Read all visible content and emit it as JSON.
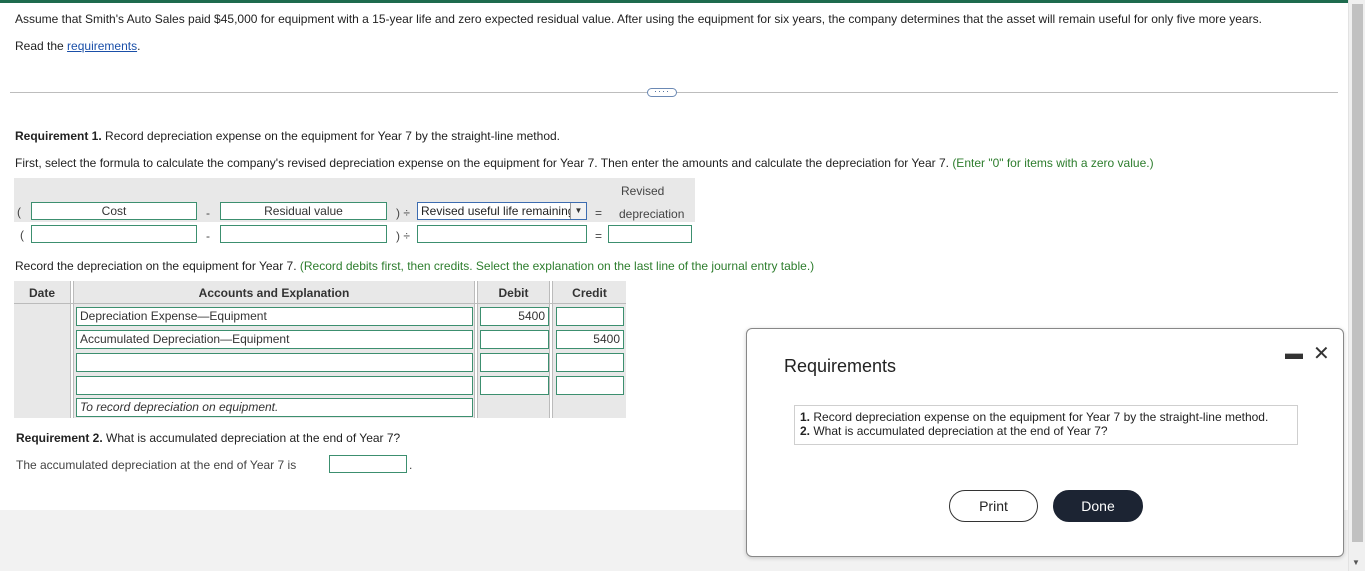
{
  "problem": {
    "text": "Assume that Smith's Auto Sales paid $45,000 for equipment with a 15-year life and zero expected residual value. After using the equipment for six years, the company determines that the asset will remain useful for only five more years.",
    "read_prefix": "Read the ",
    "read_link": "requirements",
    "read_suffix": "."
  },
  "expand_label": "····",
  "req1": {
    "label": "Requirement 1.",
    "text": " Record depreciation expense on the equipment for Year 7 by the straight-line method."
  },
  "instructions": {
    "text": "First, select the formula to calculate the company's revised depreciation expense on the equipment for Year 7. Then enter the amounts and calculate the depreciation for Year 7. ",
    "hint": "(Enter \"0\" for items with a zero value.)"
  },
  "formula": {
    "open_paren": "(",
    "minus": "-",
    "close_div": ") ÷",
    "equals": "=",
    "cost_label": "Cost",
    "residual_label": "Residual value",
    "divisor_selected": "Revised useful life remaining",
    "result_header_1": "Revised",
    "result_header_2": "depreciation",
    "dropdown_arrow": "▼"
  },
  "record": {
    "text": "Record the depreciation on the equipment for Year 7. ",
    "hint": "(Record debits first, then credits. Select the explanation on the last line of the journal entry table.)"
  },
  "journal": {
    "headers": {
      "date": "Date",
      "accounts": "Accounts and Explanation",
      "debit": "Debit",
      "credit": "Credit"
    },
    "rows": [
      {
        "account": "Depreciation Expense—Equipment",
        "debit": "5400",
        "credit": ""
      },
      {
        "account": "Accumulated Depreciation—Equipment",
        "debit": "",
        "credit": "5400"
      },
      {
        "account": "",
        "debit": "",
        "credit": ""
      },
      {
        "account": "",
        "debit": "",
        "credit": ""
      }
    ],
    "explanation": "To record depreciation on equipment."
  },
  "req2": {
    "label": "Requirement 2.",
    "text": " What is accumulated depreciation at the end of Year 7?",
    "answer_text": "The accumulated depreciation at the end of Year 7 is",
    "period": "."
  },
  "modal": {
    "title": "Requirements",
    "items": [
      {
        "num": "1.",
        "text": " Record depreciation expense on the equipment for Year 7 by the straight-line method."
      },
      {
        "num": "2.",
        "text": " What is accumulated depreciation at the end of Year 7?"
      }
    ],
    "print_label": "Print",
    "done_label": "Done",
    "minimize_glyph": "▬",
    "close_glyph": "✕"
  }
}
